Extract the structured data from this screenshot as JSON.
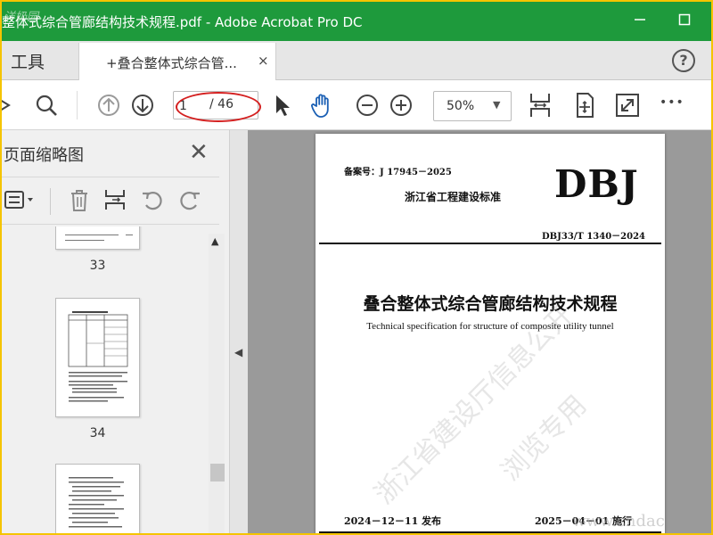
{
  "window": {
    "title": "整体式综合管廊结构技术规程.pdf - Adobe Acrobat Pro DC",
    "corner_watermark": "洋奶园",
    "site_watermark": "www.cndac"
  },
  "tabs": {
    "tools_label": "工具",
    "document_tab_label": "+叠合整体式综合管...",
    "close_glyph": "×",
    "help_glyph": "?"
  },
  "toolbar": {
    "current_page": "1",
    "total_pages": "/ 46",
    "zoom_value": "50%",
    "zoom_arrow": "▼",
    "more_glyph": "•••"
  },
  "sidebar": {
    "title": "页面缩略图",
    "close_glyph": "✕",
    "thumbnails": [
      {
        "page_label": "33"
      },
      {
        "page_label": "34"
      }
    ],
    "scroll_up_glyph": "▲"
  },
  "splitter": {
    "collapse_glyph": "◀"
  },
  "page": {
    "filing_number": "备案号：J 17945－2025",
    "standard_type": "浙江省工程建设标准",
    "brand": "DBJ",
    "standard_code": "DBJ33/T 1340－2024",
    "title_cn": "叠合整体式综合管廊结构技术规程",
    "title_en": "Technical specification for structure of composite utility tunnel",
    "issue_date": "2024－12－11 发布",
    "implement_date": "2025－04－01 施行",
    "watermarks": [
      "浙江省建设厅信息公开",
      "浏览专用"
    ]
  },
  "colors": {
    "title_bar": "#1e9a3c",
    "outer_frame": "#f5c400",
    "accent_blue": "#1a5fb4",
    "annotation_red": "#d42020"
  },
  "icons": {
    "toolbar": [
      "stamp-icon",
      "search-icon",
      "prev-page-icon",
      "next-page-icon",
      "select-pointer-icon",
      "hand-tool-icon",
      "zoom-out-icon",
      "zoom-in-icon",
      "fit-width-icon",
      "rotate-page-icon",
      "fullscreen-icon",
      "more-icon"
    ],
    "sidebar": [
      "options-icon",
      "trash-icon",
      "insert-page-icon",
      "undo-icon",
      "redo-icon"
    ]
  }
}
